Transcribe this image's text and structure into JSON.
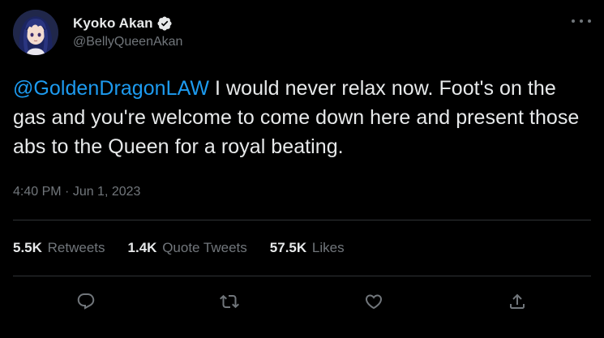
{
  "user": {
    "display_name": "Kyoko Akan",
    "handle": "@BellyQueenAkan",
    "verified": true,
    "avatar_icon": "anime-character-avatar"
  },
  "tweet": {
    "mention": "@GoldenDragonLAW",
    "text": " I would never relax now. Foot's on the gas and you're welcome to come down here and present those abs to the Queen for a royal beating.",
    "time": "4:40 PM",
    "separator": " · ",
    "date": "Jun 1, 2023"
  },
  "stats": [
    {
      "value": "5.5K",
      "label": "Retweets"
    },
    {
      "value": "1.4K",
      "label": "Quote Tweets"
    },
    {
      "value": "57.5K",
      "label": "Likes"
    }
  ],
  "actions": [
    "reply-icon",
    "retweet-icon",
    "like-icon",
    "share-icon"
  ],
  "colors": {
    "background": "#000000",
    "text": "#e7e9ea",
    "secondary": "#71767b",
    "accent": "#1d9bf0",
    "divider": "#2f3336"
  }
}
